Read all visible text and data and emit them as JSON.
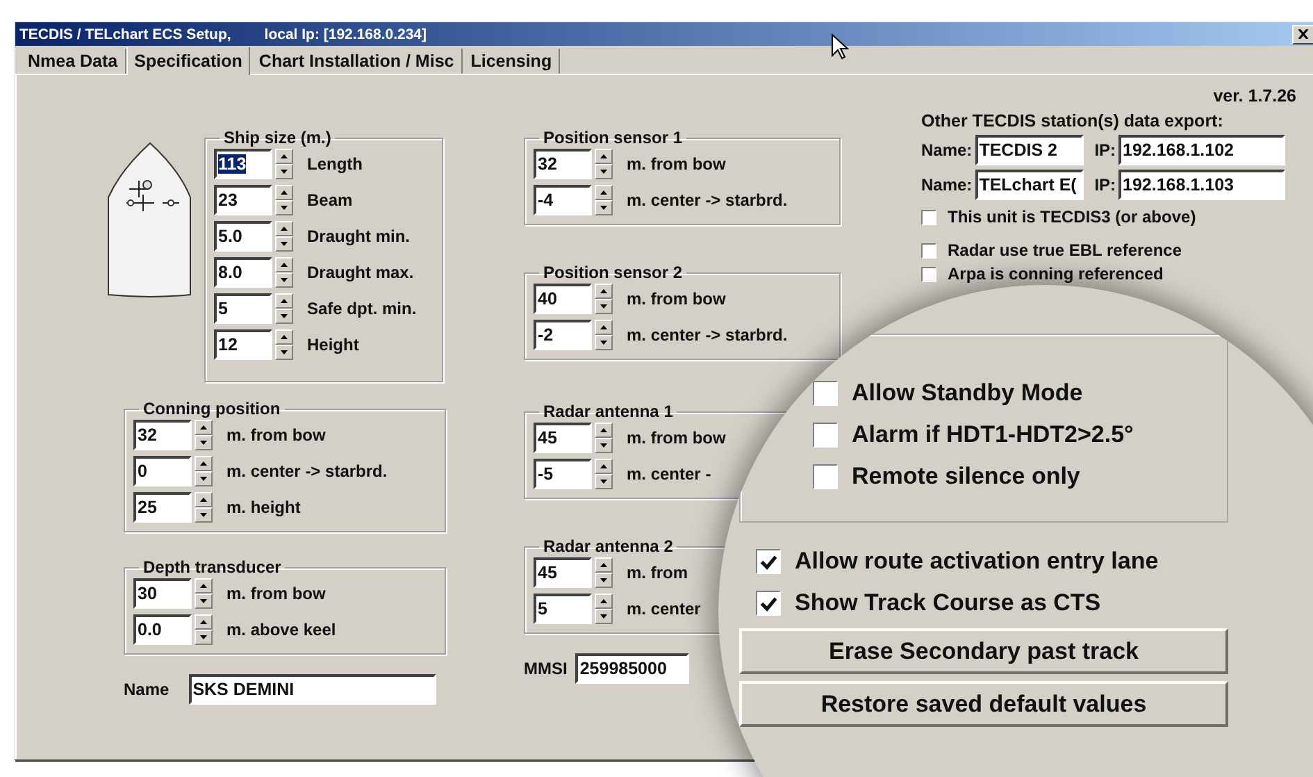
{
  "window": {
    "title": "TECDIS / TELchart ECS Setup,",
    "local_ip": "local Ip: [192.168.0.234]"
  },
  "tabs": [
    {
      "label": "Nmea Data",
      "selected": false
    },
    {
      "label": "Specification",
      "selected": true
    },
    {
      "label": "Chart Installation / Misc",
      "selected": false
    },
    {
      "label": "Licensing",
      "selected": false
    }
  ],
  "version": "ver. 1.7.26",
  "ship_size": {
    "title": "Ship size (m.)",
    "fields": [
      {
        "value": "113",
        "label": "Length",
        "highlighted": true
      },
      {
        "value": "23",
        "label": "Beam",
        "highlighted": false
      },
      {
        "value": "5.0",
        "label": "Draught min.",
        "highlighted": false
      },
      {
        "value": "8.0",
        "label": "Draught max.",
        "highlighted": false
      },
      {
        "value": "5",
        "label": "Safe dpt. min.",
        "highlighted": false
      },
      {
        "value": "12",
        "label": "Height",
        "highlighted": false
      }
    ]
  },
  "left_groups": [
    {
      "title": "Conning position",
      "fields": [
        {
          "value": "32",
          "label": "m. from bow"
        },
        {
          "value": "0",
          "label": "m. center -> starbrd."
        },
        {
          "value": "25",
          "label": "m. height"
        }
      ]
    },
    {
      "title": "Depth transducer",
      "fields": [
        {
          "value": "30",
          "label": "m. from bow"
        },
        {
          "value": "0.0",
          "label": "m. above keel"
        }
      ]
    }
  ],
  "name_field": {
    "label": "Name",
    "value": "SKS DEMINI"
  },
  "middle_groups": [
    {
      "title": "Position sensor 1",
      "fields": [
        {
          "value": "32",
          "label": "m. from bow"
        },
        {
          "value": "-4",
          "label": "m. center -> starbrd."
        }
      ]
    },
    {
      "title": "Position sensor 2",
      "fields": [
        {
          "value": "40",
          "label": "m. from bow"
        },
        {
          "value": "-2",
          "label": "m. center -> starbrd."
        }
      ]
    },
    {
      "title": "Radar antenna 1",
      "fields": [
        {
          "value": "45",
          "label": "m. from bow"
        },
        {
          "value": "-5",
          "label": "m. center -"
        }
      ]
    },
    {
      "title": "Radar antenna 2",
      "fields": [
        {
          "value": "45",
          "label": "m. from"
        },
        {
          "value": "5",
          "label": "m. center"
        }
      ]
    }
  ],
  "mmsi_field": {
    "label": "MMSI",
    "value": "259985000"
  },
  "export": {
    "title": "Other TECDIS station(s) data export:",
    "stations": [
      {
        "name_label": "Name:",
        "name": "TECDIS 2",
        "ip_label": "IP:",
        "ip": "192.168.1.102"
      },
      {
        "name_label": "Name:",
        "name": "TELchart E(",
        "ip_label": "IP:",
        "ip": "192.168.1.103"
      }
    ],
    "options": [
      {
        "label": "This unit is TECDIS3 (or above)",
        "checked": false
      },
      {
        "label": "Radar use true EBL reference",
        "checked": false
      },
      {
        "label": "Arpa is conning referenced",
        "checked": false
      }
    ]
  },
  "magnifier": {
    "group_options": [
      {
        "label": "Allow Standby Mode",
        "checked": false
      },
      {
        "label": "Alarm if HDT1-HDT2>2.5°",
        "checked": false
      },
      {
        "label": "Remote silence only",
        "checked": false
      }
    ],
    "options": [
      {
        "label": "Allow route activation entry lane",
        "checked": true
      },
      {
        "label": "Show Track Course as CTS",
        "checked": true
      }
    ],
    "buttons": [
      "Erase Secondary past track",
      "Restore saved default values"
    ]
  }
}
